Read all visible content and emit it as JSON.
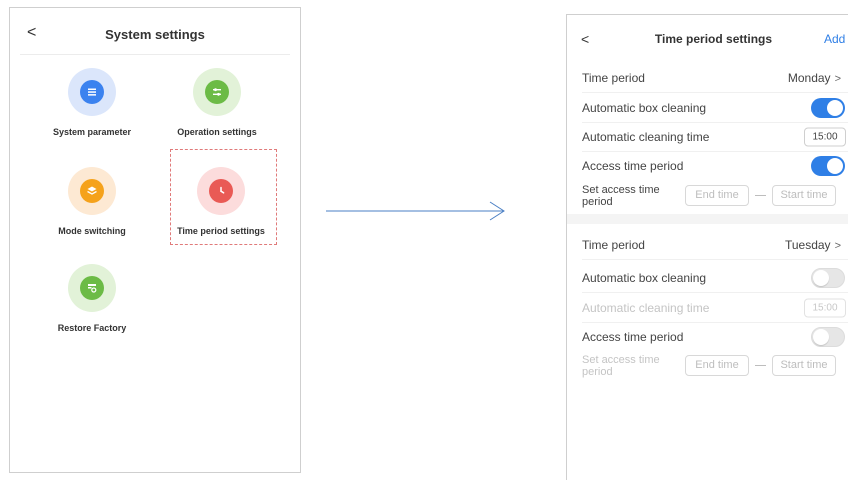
{
  "system_settings": {
    "title": "System settings",
    "back_label": "<",
    "tiles": [
      {
        "label": "System parameter",
        "icon": "system-parameter-icon"
      },
      {
        "label": "Operation settings",
        "icon": "operation-settings-icon"
      },
      {
        "label": "Mode switching",
        "icon": "mode-switching-icon"
      },
      {
        "label": "Time period settings",
        "icon": "time-period-icon"
      },
      {
        "label": "Restore Factory",
        "icon": "restore-factory-icon"
      }
    ],
    "highlighted_tile": "Time period settings"
  },
  "time_period_settings": {
    "title": "Time period settings",
    "back_label": "<",
    "add_label": "Add",
    "accent_color": "#2f7fe6",
    "periods": [
      {
        "period_label": "Time period",
        "day": "Monday",
        "auto_box_cleaning_label": "Automatic box cleaning",
        "auto_box_cleaning_on": true,
        "auto_cleaning_time_label": "Automatic cleaning time",
        "auto_cleaning_time": "15:00",
        "access_time_label": "Access time period",
        "access_time_on": true,
        "set_access_label": "Set access time period",
        "end_time_placeholder": "End time",
        "start_time_placeholder": "Start time"
      },
      {
        "period_label": "Time period",
        "day": "Tuesday",
        "auto_box_cleaning_label": "Automatic box cleaning",
        "auto_box_cleaning_on": false,
        "auto_cleaning_time_label": "Automatic cleaning time",
        "auto_cleaning_time": "15:00",
        "access_time_label": "Access time period",
        "access_time_on": false,
        "set_access_label": "Set access time period",
        "end_time_placeholder": "End time",
        "start_time_placeholder": "Start time"
      }
    ]
  }
}
